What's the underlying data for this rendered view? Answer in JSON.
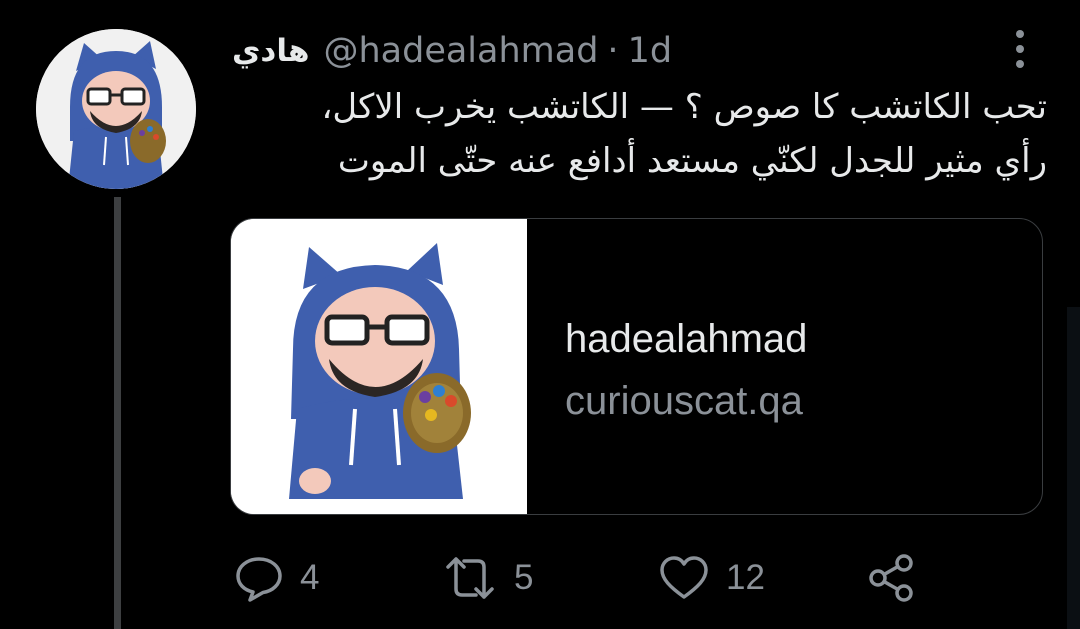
{
  "tweet": {
    "display_name": "هادي",
    "handle": "@hadealahmad",
    "separator": "·",
    "time": "1d",
    "text_lines": [
      "تحب الكاتشب كا صوص ؟ — الكاتشب يخرب الاكل،",
      "رأي مثير للجدل لكنّي مستعد أدافع عنه حتّى الموت"
    ]
  },
  "card": {
    "title": "hadealahmad",
    "domain": "curiouscat.qa"
  },
  "actions": {
    "reply_count": "4",
    "retweet_count": "5",
    "like_count": "12"
  },
  "icons": {
    "more": "more-vertical-icon",
    "reply": "reply-icon",
    "retweet": "retweet-icon",
    "like": "heart-icon",
    "share": "share-icon"
  },
  "colors": {
    "background": "#000000",
    "text_primary": "#e7e9ea",
    "text_secondary": "#8b9198",
    "hoodie_blue": "#3f5fae"
  }
}
